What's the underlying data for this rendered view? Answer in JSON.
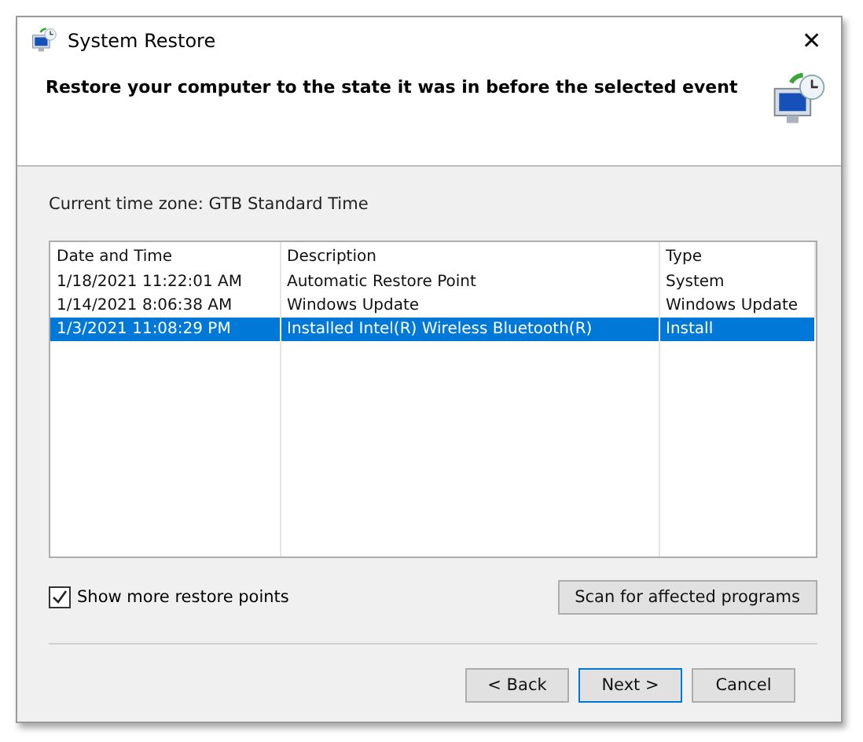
{
  "window": {
    "title": "System Restore",
    "close": "✕"
  },
  "header": {
    "heading": "Restore your computer to the state it was in before the selected event"
  },
  "time_zone": "Current time zone: GTB Standard Time",
  "table": {
    "columns": [
      "Date and Time",
      "Description",
      "Type"
    ],
    "rows": [
      {
        "cells": [
          "1/18/2021 11:22:01 AM",
          "Automatic Restore Point",
          "System"
        ],
        "selected": false
      },
      {
        "cells": [
          "1/14/2021 8:06:38 AM",
          "Windows Update",
          "Windows Update"
        ],
        "selected": false
      },
      {
        "cells": [
          "1/3/2021 11:08:29 PM",
          "Installed Intel(R) Wireless Bluetooth(R)",
          "Install"
        ],
        "selected": true
      }
    ]
  },
  "show_more": {
    "label": "Show more restore points",
    "checked": true
  },
  "scan_button": "Scan for affected programs",
  "buttons": [
    {
      "label": "< Back",
      "focused": false
    },
    {
      "label": "Next >",
      "focused": true
    },
    {
      "label": "Cancel",
      "focused": false
    }
  ]
}
